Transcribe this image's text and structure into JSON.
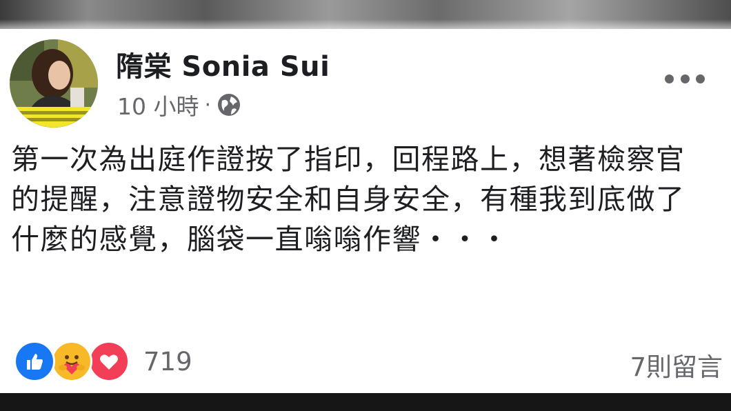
{
  "post": {
    "author": "隋棠 Sonia Sui",
    "time": "10 小時",
    "separator": "·",
    "audience_icon": "globe-icon",
    "menu_icon": "more-options-icon",
    "text": "第一次為出庭作證按了指印，回程路上，想著檢察官的提醒，注意證物安全和自身安全，有種我到底做了什麼的感覺，腦袋一直嗡嗡作響・・・"
  },
  "footer": {
    "reactions": [
      "like-icon",
      "care-icon",
      "love-icon"
    ],
    "reaction_count": "719",
    "comments": "7則留言"
  },
  "colors": {
    "like": "#1877f2",
    "care": "#f7b928",
    "love": "#f33e58",
    "secondary_text": "#65676b"
  }
}
